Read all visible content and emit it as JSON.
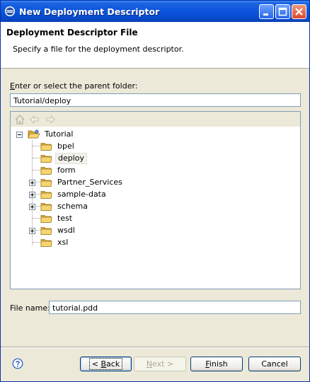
{
  "window": {
    "title": "New Deployment Descriptor"
  },
  "header": {
    "title": "Deployment Descriptor File",
    "subtitle": "Specify a file for the deployment descriptor."
  },
  "parent_folder": {
    "label_mnemonic": "E",
    "label_rest": "nter or select the parent folder:",
    "value": "Tutorial/deploy"
  },
  "tree": {
    "root": "Tutorial",
    "items": [
      {
        "label": "bpel",
        "expandable": false,
        "selected": false
      },
      {
        "label": "deploy",
        "expandable": false,
        "selected": true
      },
      {
        "label": "form",
        "expandable": false,
        "selected": false
      },
      {
        "label": "Partner_Services",
        "expandable": true,
        "selected": false
      },
      {
        "label": "sample-data",
        "expandable": true,
        "selected": false
      },
      {
        "label": "schema",
        "expandable": true,
        "selected": false
      },
      {
        "label": "test",
        "expandable": false,
        "selected": false
      },
      {
        "label": "wsdl",
        "expandable": true,
        "selected": false
      },
      {
        "label": "xsl",
        "expandable": false,
        "selected": false
      }
    ]
  },
  "file_name": {
    "label": "File name:",
    "value": "tutorial.pdd"
  },
  "buttons": {
    "back_mnemonic": "B",
    "back_prefix": "< ",
    "back_rest": "ack",
    "next_mnemonic": "N",
    "next_rest": "ext >",
    "finish_mnemonic": "F",
    "finish_rest": "inish",
    "cancel": "Cancel"
  },
  "colors": {
    "titlebar": "#0a55dd",
    "folder": "#f5c94e",
    "dialog_bg": "#ece9d8"
  },
  "icons": [
    "eclipse-icon",
    "minimize-icon",
    "maximize-icon",
    "close-icon",
    "home-icon",
    "back-arrow-icon",
    "forward-arrow-icon",
    "folder-icon",
    "help-icon"
  ]
}
